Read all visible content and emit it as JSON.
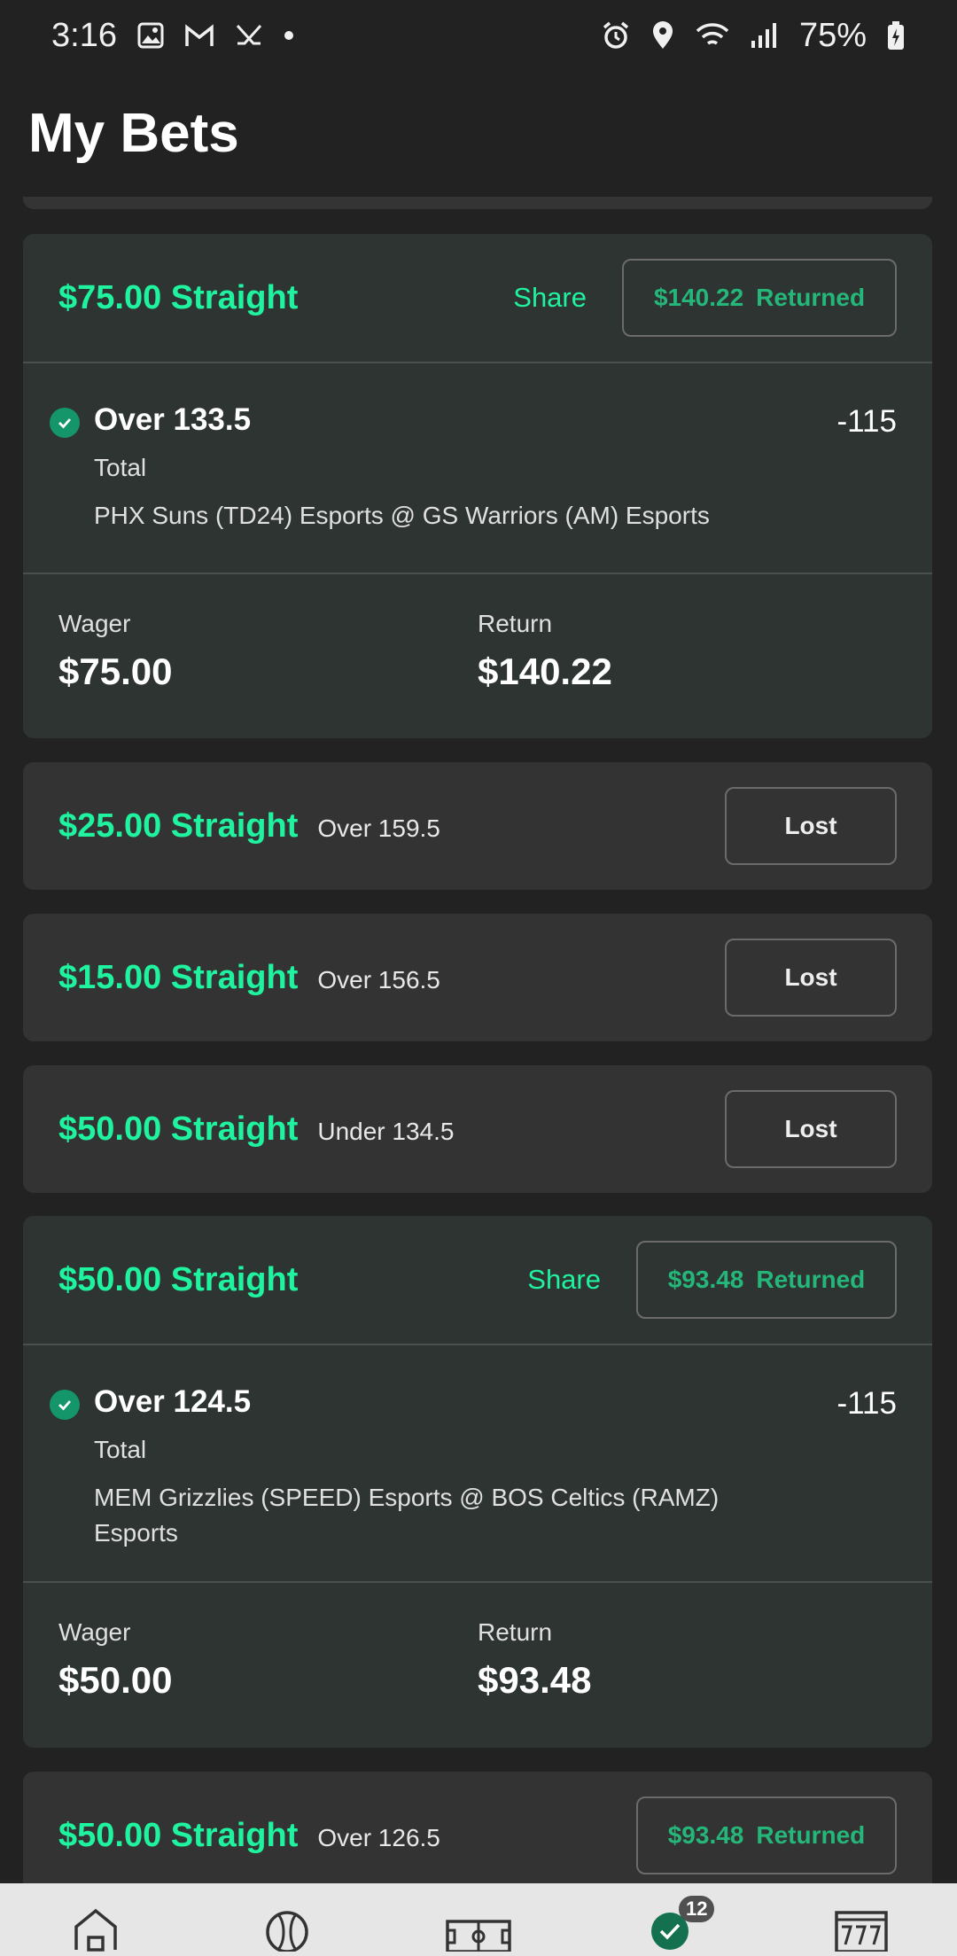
{
  "status_bar": {
    "time": "3:16",
    "battery": "75%"
  },
  "page": {
    "title": "My Bets"
  },
  "bets": [
    {
      "title": "$75.00 Straight",
      "share_label": "Share",
      "returned_amount": "$140.22",
      "returned_label": "Returned",
      "selection": "Over 133.5",
      "odds": "-115",
      "market": "Total",
      "event": "PHX Suns (TD24) Esports @ GS Warriors (AM) Esports",
      "wager_label": "Wager",
      "wager": "$75.00",
      "return_label": "Return",
      "return": "$140.22"
    },
    {
      "title": "$25.00 Straight",
      "selection": "Over 159.5",
      "status": "Lost"
    },
    {
      "title": "$15.00 Straight",
      "selection": "Over 156.5",
      "status": "Lost"
    },
    {
      "title": "$50.00 Straight",
      "selection": "Under 134.5",
      "status": "Lost"
    },
    {
      "title": "$50.00 Straight",
      "share_label": "Share",
      "returned_amount": "$93.48",
      "returned_label": "Returned",
      "selection": "Over 124.5",
      "odds": "-115",
      "market": "Total",
      "event": "MEM Grizzlies (SPEED) Esports @ BOS Celtics (RAMZ) Esports",
      "wager_label": "Wager",
      "wager": "$50.00",
      "return_label": "Return",
      "return": "$93.48"
    },
    {
      "title": "$50.00 Straight",
      "selection": "Over 126.5",
      "returned_amount": "$93.48",
      "returned_label": "Returned"
    }
  ],
  "bottom_nav": {
    "items": [
      "home-icon",
      "sports-ball-icon",
      "field-icon",
      "my-bets-check-icon",
      "casino-777-icon"
    ],
    "badge": "12"
  },
  "colors": {
    "accent": "#1ff3a0",
    "returned": "#25b67a",
    "background": "#222222",
    "card": "#333333"
  }
}
